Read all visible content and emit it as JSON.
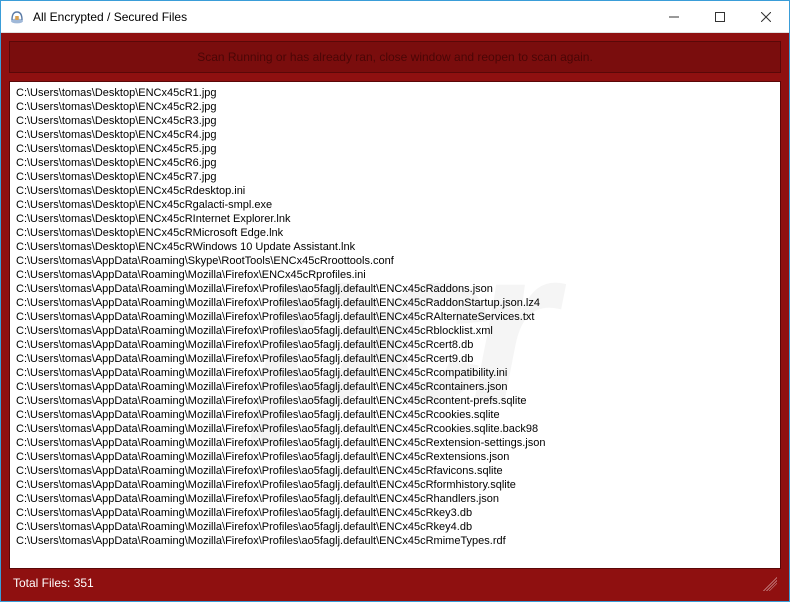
{
  "window": {
    "title": "All Encrypted / Secured Files"
  },
  "banner": {
    "text": "Scan Running or has already ran, close window and reopen to scan again."
  },
  "files": [
    "C:\\Users\\tomas\\Desktop\\ENCx45cR1.jpg",
    "C:\\Users\\tomas\\Desktop\\ENCx45cR2.jpg",
    "C:\\Users\\tomas\\Desktop\\ENCx45cR3.jpg",
    "C:\\Users\\tomas\\Desktop\\ENCx45cR4.jpg",
    "C:\\Users\\tomas\\Desktop\\ENCx45cR5.jpg",
    "C:\\Users\\tomas\\Desktop\\ENCx45cR6.jpg",
    "C:\\Users\\tomas\\Desktop\\ENCx45cR7.jpg",
    "C:\\Users\\tomas\\Desktop\\ENCx45cRdesktop.ini",
    "C:\\Users\\tomas\\Desktop\\ENCx45cRgalacti-smpl.exe",
    "C:\\Users\\tomas\\Desktop\\ENCx45cRInternet Explorer.lnk",
    "C:\\Users\\tomas\\Desktop\\ENCx45cRMicrosoft Edge.lnk",
    "C:\\Users\\tomas\\Desktop\\ENCx45cRWindows 10 Update Assistant.lnk",
    "C:\\Users\\tomas\\AppData\\Roaming\\Skype\\RootTools\\ENCx45cRroottools.conf",
    "C:\\Users\\tomas\\AppData\\Roaming\\Mozilla\\Firefox\\ENCx45cRprofiles.ini",
    "C:\\Users\\tomas\\AppData\\Roaming\\Mozilla\\Firefox\\Profiles\\ao5faglj.default\\ENCx45cRaddons.json",
    "C:\\Users\\tomas\\AppData\\Roaming\\Mozilla\\Firefox\\Profiles\\ao5faglj.default\\ENCx45cRaddonStartup.json.lz4",
    "C:\\Users\\tomas\\AppData\\Roaming\\Mozilla\\Firefox\\Profiles\\ao5faglj.default\\ENCx45cRAlternateServices.txt",
    "C:\\Users\\tomas\\AppData\\Roaming\\Mozilla\\Firefox\\Profiles\\ao5faglj.default\\ENCx45cRblocklist.xml",
    "C:\\Users\\tomas\\AppData\\Roaming\\Mozilla\\Firefox\\Profiles\\ao5faglj.default\\ENCx45cRcert8.db",
    "C:\\Users\\tomas\\AppData\\Roaming\\Mozilla\\Firefox\\Profiles\\ao5faglj.default\\ENCx45cRcert9.db",
    "C:\\Users\\tomas\\AppData\\Roaming\\Mozilla\\Firefox\\Profiles\\ao5faglj.default\\ENCx45cRcompatibility.ini",
    "C:\\Users\\tomas\\AppData\\Roaming\\Mozilla\\Firefox\\Profiles\\ao5faglj.default\\ENCx45cRcontainers.json",
    "C:\\Users\\tomas\\AppData\\Roaming\\Mozilla\\Firefox\\Profiles\\ao5faglj.default\\ENCx45cRcontent-prefs.sqlite",
    "C:\\Users\\tomas\\AppData\\Roaming\\Mozilla\\Firefox\\Profiles\\ao5faglj.default\\ENCx45cRcookies.sqlite",
    "C:\\Users\\tomas\\AppData\\Roaming\\Mozilla\\Firefox\\Profiles\\ao5faglj.default\\ENCx45cRcookies.sqlite.back98",
    "C:\\Users\\tomas\\AppData\\Roaming\\Mozilla\\Firefox\\Profiles\\ao5faglj.default\\ENCx45cRextension-settings.json",
    "C:\\Users\\tomas\\AppData\\Roaming\\Mozilla\\Firefox\\Profiles\\ao5faglj.default\\ENCx45cRextensions.json",
    "C:\\Users\\tomas\\AppData\\Roaming\\Mozilla\\Firefox\\Profiles\\ao5faglj.default\\ENCx45cRfavicons.sqlite",
    "C:\\Users\\tomas\\AppData\\Roaming\\Mozilla\\Firefox\\Profiles\\ao5faglj.default\\ENCx45cRformhistory.sqlite",
    "C:\\Users\\tomas\\AppData\\Roaming\\Mozilla\\Firefox\\Profiles\\ao5faglj.default\\ENCx45cRhandlers.json",
    "C:\\Users\\tomas\\AppData\\Roaming\\Mozilla\\Firefox\\Profiles\\ao5faglj.default\\ENCx45cRkey3.db",
    "C:\\Users\\tomas\\AppData\\Roaming\\Mozilla\\Firefox\\Profiles\\ao5faglj.default\\ENCx45cRkey4.db",
    "C:\\Users\\tomas\\AppData\\Roaming\\Mozilla\\Firefox\\Profiles\\ao5faglj.default\\ENCx45cRmimeTypes.rdf"
  ],
  "status": {
    "total_label": "Total Files:",
    "total_value": "351"
  },
  "watermark": "pcr"
}
